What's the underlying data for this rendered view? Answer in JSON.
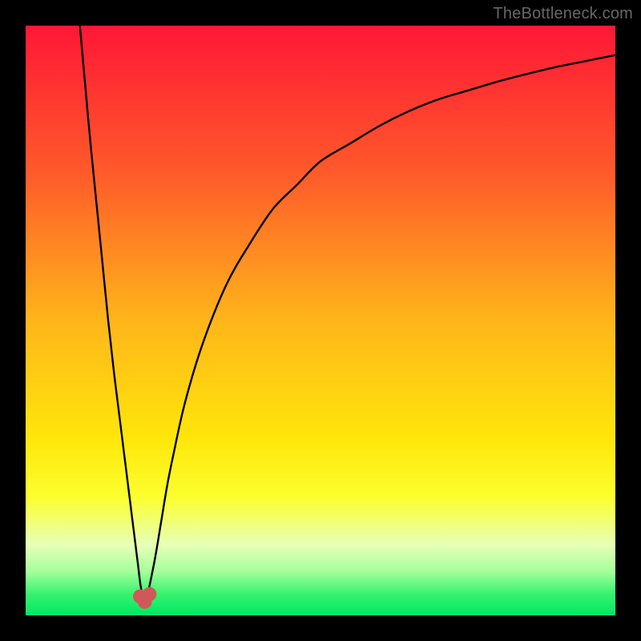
{
  "watermark": "TheBottleneck.com",
  "chart_data": {
    "type": "line",
    "title": "",
    "xlabel": "",
    "ylabel": "",
    "xlim": [
      0,
      100
    ],
    "ylim": [
      0,
      100
    ],
    "gradient_stops": [
      {
        "offset": 0,
        "color": "#ff1736"
      },
      {
        "offset": 0.25,
        "color": "#ff5a2a"
      },
      {
        "offset": 0.5,
        "color": "#ffb51a"
      },
      {
        "offset": 0.7,
        "color": "#ffe60a"
      },
      {
        "offset": 0.8,
        "color": "#fbff2e"
      },
      {
        "offset": 0.88,
        "color": "#e7ffb7"
      },
      {
        "offset": 0.925,
        "color": "#a6ff9c"
      },
      {
        "offset": 0.965,
        "color": "#34f26e"
      },
      {
        "offset": 1.0,
        "color": "#00e865"
      }
    ],
    "series": [
      {
        "name": "bottleneck-curve",
        "x": [
          9.2,
          10,
          11,
          12,
          13,
          14,
          15,
          16,
          17,
          18,
          19,
          19.5,
          20,
          20.5,
          21,
          22,
          23,
          24,
          25,
          27,
          30,
          34,
          38,
          42,
          46,
          50,
          55,
          60,
          65,
          70,
          75,
          80,
          85,
          90,
          95,
          100
        ],
        "y": [
          100,
          91,
          80,
          70,
          60,
          50,
          41,
          33,
          25,
          17,
          9,
          5,
          3,
          3,
          5,
          10,
          16,
          22,
          27,
          36,
          46,
          56,
          63,
          69,
          73,
          77,
          80,
          83,
          85.5,
          87.5,
          89,
          90.5,
          91.8,
          93,
          94,
          95
        ]
      }
    ],
    "markers": [
      {
        "name": "min-marker-left",
        "x": 19.4,
        "y": 3.2,
        "r": 1.2,
        "color": "#cf5959"
      },
      {
        "name": "min-marker-right",
        "x": 21.0,
        "y": 3.6,
        "r": 1.2,
        "color": "#cf5959"
      },
      {
        "name": "min-marker-base",
        "x": 20.2,
        "y": 2.3,
        "r": 1.2,
        "color": "#cf5959"
      }
    ]
  }
}
